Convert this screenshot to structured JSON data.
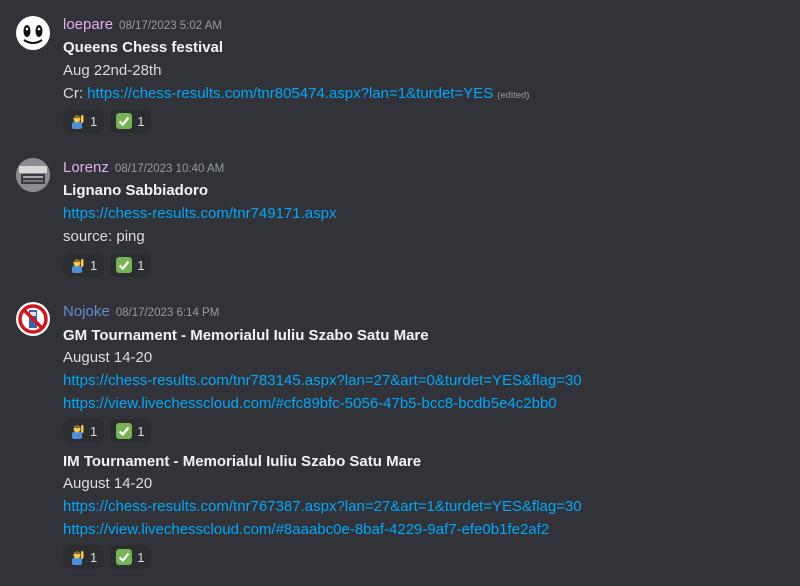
{
  "messages": [
    {
      "username": "loepare",
      "timestamp": "08/17/2023 5:02 AM",
      "title": "Queens Chess festival",
      "lines": [
        "Aug 22nd-28th"
      ],
      "credit_prefix": "Cr: ",
      "link": "https://chess-results.com/tnr805474.aspx?lan=1&turdet=YES",
      "edited": "(edited)",
      "reactions": [
        {
          "emoji": "person-raising-hand-icon",
          "count": "1"
        },
        {
          "emoji": "check-mark-icon",
          "count": "1"
        }
      ]
    },
    {
      "username": "Lorenz",
      "timestamp": "08/17/2023 10:40 AM",
      "title": "Lignano Sabbiadoro",
      "link": "https://chess-results.com/tnr749171.aspx",
      "source": "source: ping",
      "reactions": [
        {
          "emoji": "person-raising-hand-icon",
          "count": "1"
        },
        {
          "emoji": "check-mark-icon",
          "count": "1"
        }
      ]
    },
    {
      "username": "Nojoke",
      "timestamp": "08/17/2023 6:14 PM",
      "title": "GM Tournament - Memorialul Iuliu Szabo Satu Mare",
      "dates": "August 14-20",
      "link1": "https://chess-results.com/tnr783145.aspx?lan=27&art=0&turdet=YES&flag=30",
      "link2": "https://view.livechesscloud.com/#cfc89bfc-5056-47b5-bcc8-bcdb5e4c2bb0",
      "reactions": [
        {
          "emoji": "person-raising-hand-icon",
          "count": "1"
        },
        {
          "emoji": "check-mark-icon",
          "count": "1"
        }
      ]
    },
    {
      "title": "IM Tournament - Memorialul Iuliu Szabo Satu Mare",
      "dates": "August 14-20",
      "link1": "https://chess-results.com/tnr767387.aspx?lan=27&art=1&turdet=YES&flag=30",
      "link2": "https://view.livechesscloud.com/#8aaabc0e-8baf-4229-9af7-efe0b1fe2af2",
      "reactions": [
        {
          "emoji": "person-raising-hand-icon",
          "count": "1"
        },
        {
          "emoji": "check-mark-icon",
          "count": "1"
        }
      ]
    }
  ],
  "colors": {
    "background": "#313338",
    "link": "#00a8fc",
    "username_loepare": "#e8a9f0",
    "username_lorenz": "#e8a9f0",
    "username_nojoke": "#5f8fcf"
  }
}
